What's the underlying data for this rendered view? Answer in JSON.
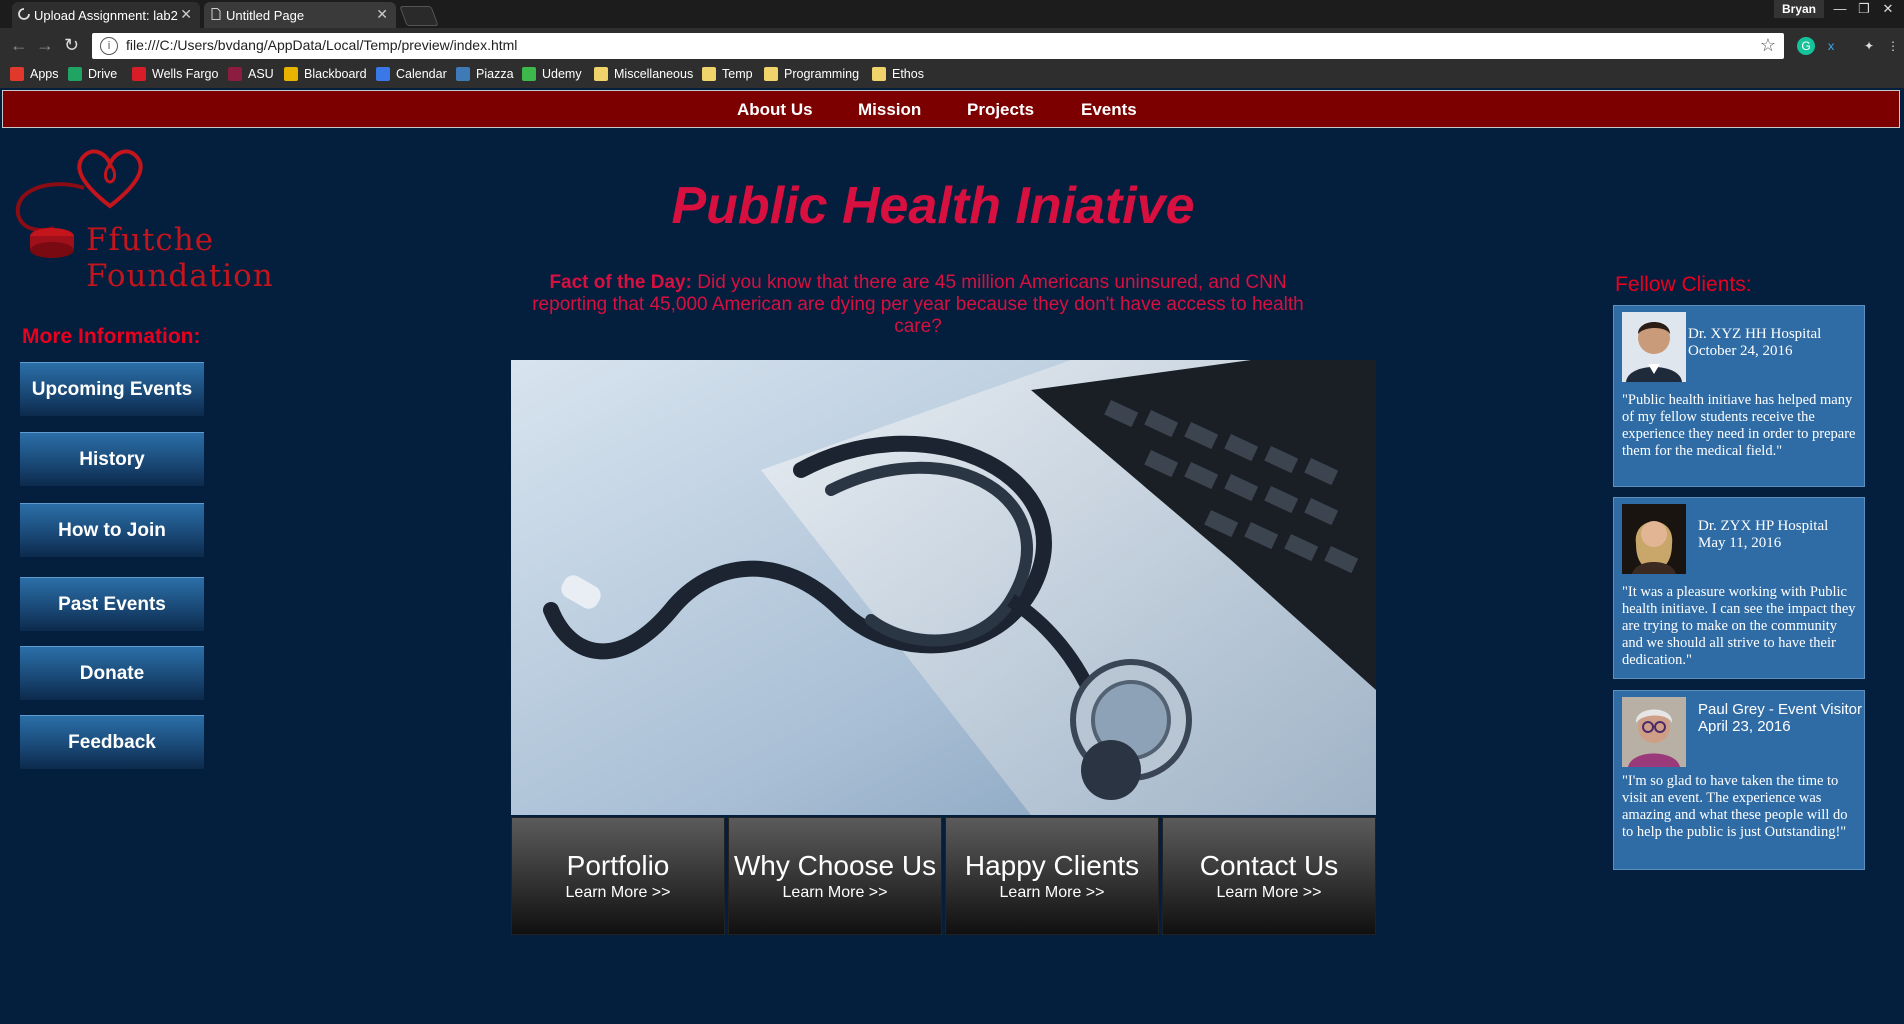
{
  "browser": {
    "tabs": [
      {
        "title": "Upload Assignment: lab2"
      },
      {
        "title": "Untitled Page"
      }
    ],
    "user": "Bryan",
    "url": "file:///C:/Users/bvdang/AppData/Local/Temp/preview/index.html",
    "bookmarks": [
      {
        "label": "Apps",
        "color": "#e0392b"
      },
      {
        "label": "Drive",
        "color": "#1fa463"
      },
      {
        "label": "Wells Fargo",
        "color": "#d71e28"
      },
      {
        "label": "ASU",
        "color": "#8c1d40"
      },
      {
        "label": "Blackboard",
        "color": "#e8b400"
      },
      {
        "label": "Calendar",
        "color": "#3b78e7"
      },
      {
        "label": "Piazza",
        "color": "#3e7bb6"
      },
      {
        "label": "Udemy",
        "color": "#3db84a"
      },
      {
        "label": "Miscellaneous",
        "color": "#f0d36a"
      },
      {
        "label": "Temp",
        "color": "#f0d36a"
      },
      {
        "label": "Programming",
        "color": "#f0d36a"
      },
      {
        "label": "Ethos",
        "color": "#f0d36a"
      }
    ]
  },
  "nav": {
    "items": [
      "About Us",
      "Mission",
      "Projects",
      "Events"
    ]
  },
  "logo": {
    "text": "Ffutche Foundation"
  },
  "title": "Public Health Iniative",
  "fact": {
    "label": "Fact of the Day:",
    "text": " Did you know that there are 45 million Americans uninsured, and CNN reporting that 45,000 American are dying per year because they don't have access to health care?"
  },
  "sidebar": {
    "heading": "More Information:",
    "buttons": [
      "Upcoming Events",
      "History",
      "How to Join",
      "Past Events",
      "Donate",
      "Feedback"
    ]
  },
  "tiles": [
    {
      "title": "Portfolio",
      "link": "Learn More >>"
    },
    {
      "title": "Why Choose Us",
      "link": "Learn More >>"
    },
    {
      "title": "Happy Clients",
      "link": "Learn More >>"
    },
    {
      "title": "Contact Us",
      "link": "Learn More >>"
    }
  ],
  "clients": {
    "heading": "Fellow Clients:",
    "cards": [
      {
        "name": "Dr. XYZ  HH Hospital",
        "date": "October 24, 2016",
        "quote": "\"Public health initiave has helped many of my fellow students receive the experience they need in order to prepare them for the medical field.\""
      },
      {
        "name": "Dr. ZYX  HP Hospital",
        "date": "May 11, 2016",
        "quote": "\"It was a pleasure working with Public health initiave. I can see the impact they are trying to make on the community and we should all strive to have their dedication.\""
      },
      {
        "name": "Paul Grey - Event Visitor",
        "date": "April 23, 2016",
        "quote": "\"I'm so glad to have taken the time to visit an event. The experience was amazing and what these people will do to help the public is just Outstanding!\""
      }
    ]
  },
  "colors": {
    "page_bg": "#041e3e",
    "nav_bg": "#7c0000",
    "accent_red": "#d81040",
    "card_blue": "#2f6ca6"
  }
}
